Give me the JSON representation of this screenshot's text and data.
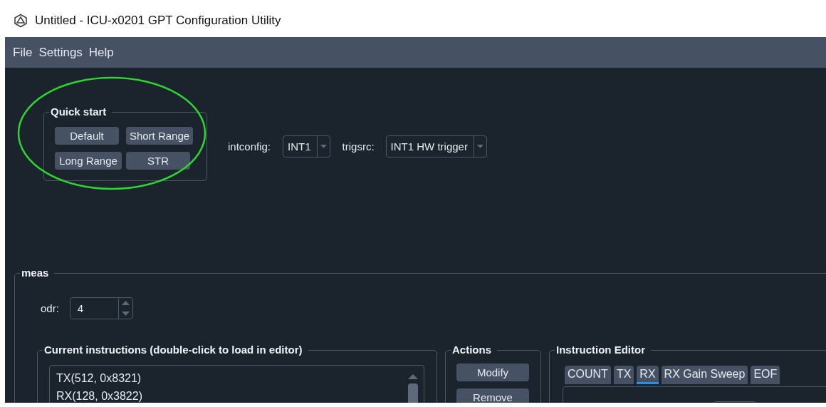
{
  "window": {
    "title": "Untitled - ICU-x0201 GPT Configuration Utility"
  },
  "menu": [
    "File",
    "Settings",
    "Help"
  ],
  "annotation": {
    "kind": "ellipse"
  },
  "quick_start": {
    "title": "Quick start",
    "buttons": [
      "Default",
      "Short Range",
      "Long Range",
      "STR"
    ]
  },
  "intconfig": {
    "label": "intconfig:",
    "value": "INT1"
  },
  "trigsrc": {
    "label": "trigsrc:",
    "value": "INT1 HW trigger"
  },
  "meas": {
    "title": "meas",
    "odr": {
      "label": "odr:",
      "value": "4"
    },
    "current_instructions": {
      "title": "Current instructions (double-click to load in editor)",
      "items": [
        "TX(512, 0x8321)",
        "RX(128, 0x3822)"
      ]
    },
    "actions": {
      "title": "Actions",
      "buttons": [
        "Modify",
        "Remove"
      ]
    },
    "instruction_editor": {
      "title": "Instruction Editor",
      "tabs": [
        {
          "label": "COUNT",
          "selected": false
        },
        {
          "label": "TX",
          "selected": false
        },
        {
          "label": "RX",
          "selected": true
        },
        {
          "label": "RX Gain Sweep",
          "selected": false
        },
        {
          "label": "EOF",
          "selected": false
        }
      ]
    }
  }
}
